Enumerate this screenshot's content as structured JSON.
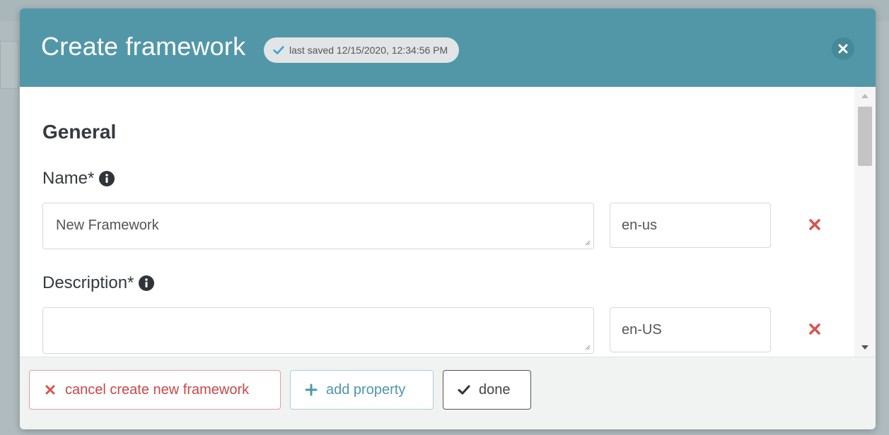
{
  "modal": {
    "title": "Create framework",
    "saved_status": "last saved 12/15/2020, 12:34:56 PM"
  },
  "section": {
    "title": "General"
  },
  "fields": {
    "name": {
      "label": "Name*",
      "value": "New Framework",
      "language": "en-us"
    },
    "description": {
      "label": "Description*",
      "value": "",
      "language": "en-US"
    }
  },
  "footer": {
    "cancel_label": "cancel create new framework",
    "add_property_label": "add property",
    "done_label": "done"
  },
  "colors": {
    "header": "#5297a8",
    "danger": "#c9474a",
    "accent": "#4f97a9"
  }
}
